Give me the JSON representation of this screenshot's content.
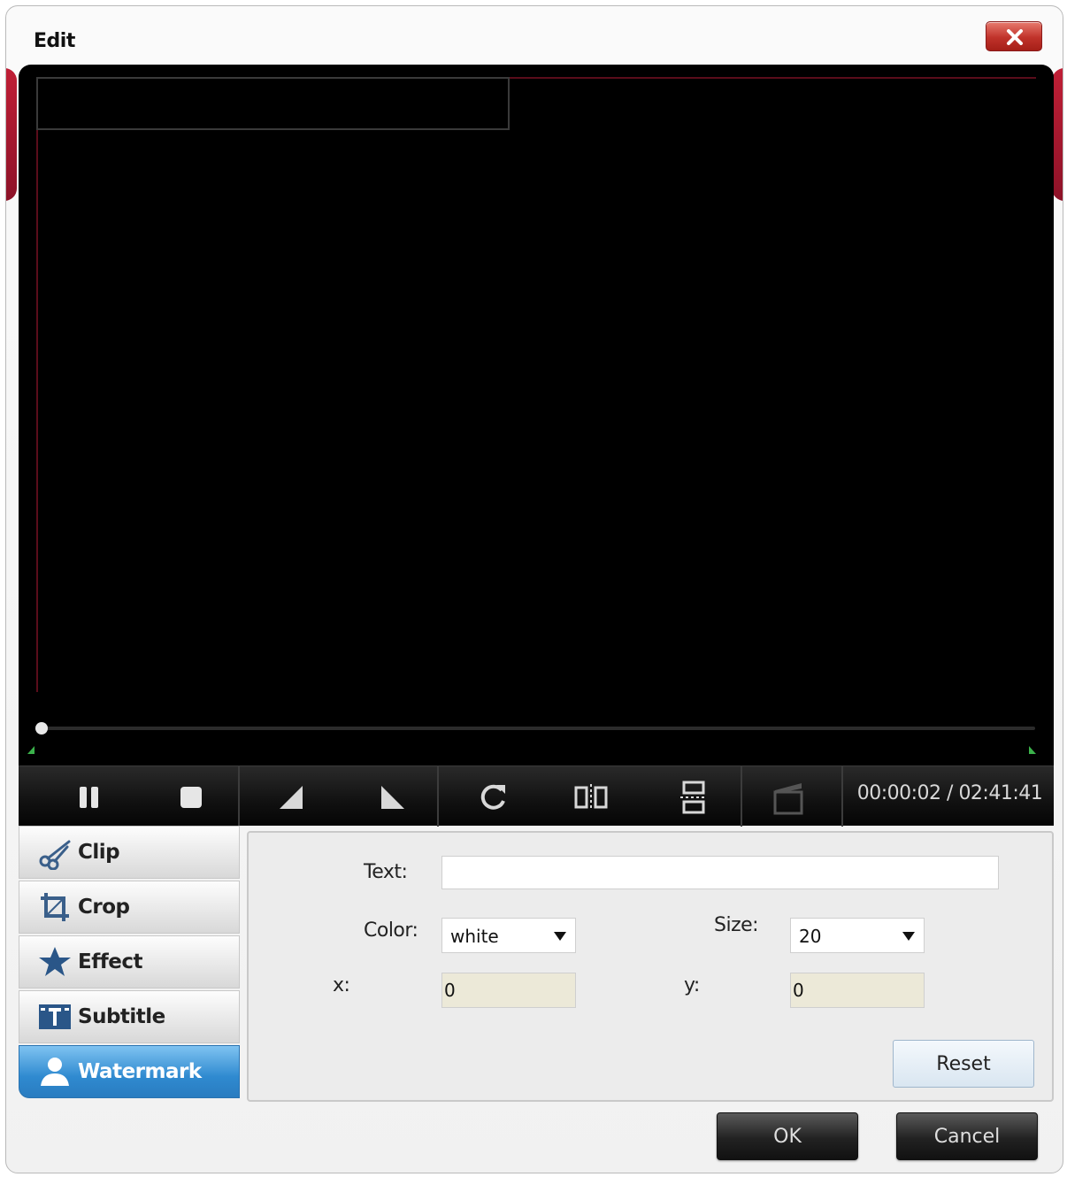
{
  "window": {
    "title": "Edit"
  },
  "player": {
    "timecode": "00:00:02 / 02:41:41"
  },
  "toolbar": {
    "icons": [
      "pause-icon",
      "stop-icon",
      "mark-in-icon",
      "mark-out-icon",
      "rotate-icon",
      "flip-horizontal-icon",
      "flip-vertical-icon",
      "snapshot-icon"
    ]
  },
  "tabs": [
    {
      "label": "Clip",
      "icon": "scissors-icon"
    },
    {
      "label": "Crop",
      "icon": "crop-icon"
    },
    {
      "label": "Effect",
      "icon": "star-icon"
    },
    {
      "label": "Subtitle",
      "icon": "subtitle-icon"
    },
    {
      "label": "Watermark",
      "icon": "person-icon",
      "active": true
    }
  ],
  "watermark": {
    "text_label": "Text:",
    "text_value": "",
    "color_label": "Color:",
    "color_value": "white",
    "size_label": "Size:",
    "size_value": "20",
    "x_label": "x:",
    "x_value": "0",
    "y_label": "y:",
    "y_value": "0",
    "reset_label": "Reset"
  },
  "buttons": {
    "ok": "OK",
    "cancel": "Cancel"
  },
  "colors": {
    "accent_red": "#c01f36",
    "active_tab": "#2f8ad0",
    "marker_green": "#3bb24b"
  }
}
